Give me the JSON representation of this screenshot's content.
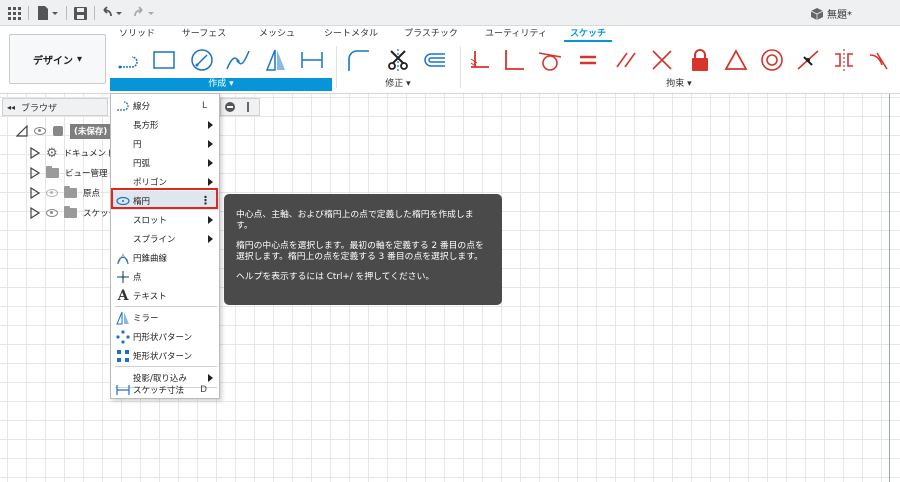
{
  "titlebar": {
    "doc_title": "無題*"
  },
  "ribbon": {
    "workspace_label": "デザイン",
    "tabs": [
      "ソリッド",
      "サーフェス",
      "メッシュ",
      "シートメタル",
      "プラスチック",
      "ユーティリティ",
      "スケッチ"
    ],
    "active_tab": "スケッチ",
    "groups": {
      "create": "作成 ▾",
      "modify": "修正 ▾",
      "constraints": "拘束 ▾"
    }
  },
  "browser": {
    "title": "ブラウザ",
    "root_label": "(未保存)",
    "items": [
      "ドキュメント",
      "ビュー管理",
      "原点",
      "スケッチ"
    ]
  },
  "menu": {
    "items": [
      {
        "label": "線分",
        "shortcut": "L"
      },
      {
        "label": "長方形"
      },
      {
        "label": "円"
      },
      {
        "label": "円弧"
      },
      {
        "label": "ポリゴン"
      },
      {
        "label": "楕円"
      },
      {
        "label": "スロット"
      },
      {
        "label": "スプライン"
      },
      {
        "label": "円錐曲線"
      },
      {
        "label": "点"
      },
      {
        "label": "テキスト"
      },
      {
        "label": "ミラー"
      },
      {
        "label": "円形状パターン"
      },
      {
        "label": "矩形状パターン"
      },
      {
        "label": "投影/取り込み"
      },
      {
        "label": "スケッチ寸法",
        "shortcut": "D"
      }
    ]
  },
  "tooltip": {
    "line1": "中心点、主軸、および楕円上の点で定義した楕円を作成します。",
    "line2": "楕円の中心点を選択します。最初の軸を定義する 2 番目の点を選択します。楕円上の点を定義する 3 番目の点を選択します。",
    "line3": "ヘルプを表示するには Ctrl+/ を押してください。"
  },
  "colors": {
    "accent": "#0696d7",
    "highlight_border": "#e0271f",
    "constraint_red": "#d9342b",
    "tooltip_bg": "#4a4a4a"
  }
}
